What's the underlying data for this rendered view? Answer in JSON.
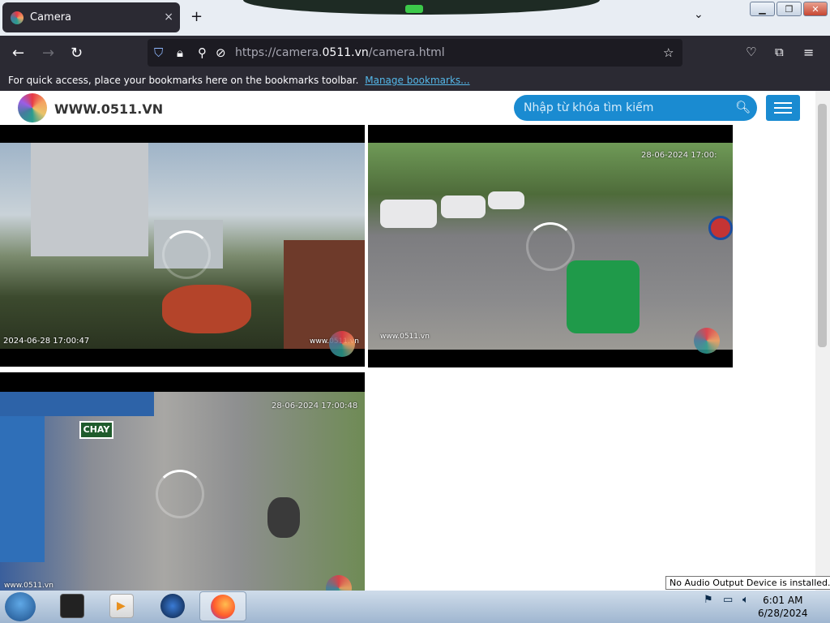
{
  "browser": {
    "tab_title": "Camera",
    "tab_close": "×",
    "new_tab": "+",
    "tab_list": "⌄",
    "url_prefix": "https://camera.",
    "url_domain": "0511.vn",
    "url_path": "/camera.html",
    "bookmarks_message": "For quick access, place your bookmarks here on the bookmarks toolbar.",
    "manage_bookmarks": "Manage bookmarks..."
  },
  "site": {
    "name": "WWW.0511.VN",
    "search_placeholder": "Nhập từ khóa tìm kiếm"
  },
  "cameras": [
    {
      "timestamp": "2024-06-28 17:00:47",
      "watermark": "www.0511.vn"
    },
    {
      "timestamp": "28-06-2024 17:00:",
      "watermark": "www.0511.vn"
    },
    {
      "timestamp": "28-06-2024 17:00:48",
      "watermark": "www.0511.vn"
    }
  ],
  "taskbar": {
    "time": "6:01 AM",
    "date": "6/28/2024",
    "tooltip": "No Audio Output Device is installed."
  },
  "colors": {
    "accent_blue": "#1a8bd1",
    "browser_dark": "#2b2a33"
  }
}
